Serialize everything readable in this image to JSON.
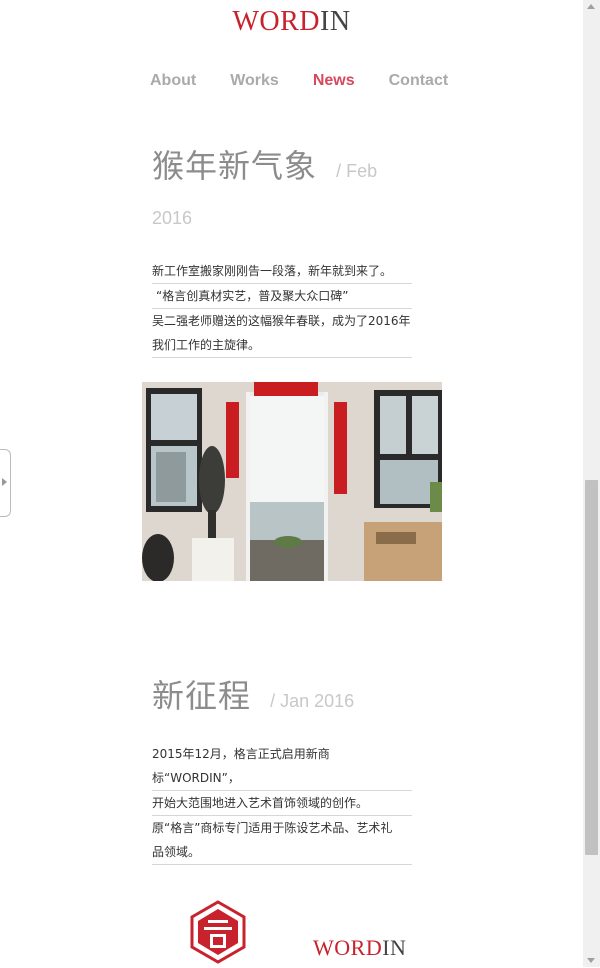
{
  "logo": {
    "part1": "WORD",
    "part2": "IN"
  },
  "nav": [
    {
      "label": "About",
      "active": false
    },
    {
      "label": "Works",
      "active": false
    },
    {
      "label": "News",
      "active": true
    },
    {
      "label": "Contact",
      "active": false
    }
  ],
  "colors": {
    "brand_red": "#c8222c",
    "nav_active": "#d8485d",
    "nav_inactive": "#aaaaaa"
  },
  "articles": [
    {
      "title": "猴年新气象",
      "date_part1": "/ Feb",
      "date_part2": "2016",
      "lines": [
        "新工作室搬家刚刚告一段落，新年就到来了。",
        "“格言创真材实艺，普及聚大众口碑”",
        "吴二强老师赠送的这幅猴年春联，成为了2016年",
        "我们工作的主旋律。"
      ]
    },
    {
      "title": "新征程",
      "date": "/ Jan 2016",
      "lines": [
        "2015年12月，格言正式启用新商",
        "标“WORDIN”，",
        "开始大范围地进入艺术首饰领域的创作。",
        "原“格言”商标专门适用于陈设艺术品、艺术礼",
        "品领域。"
      ]
    }
  ],
  "footer_logo": {
    "part1": "WORD",
    "part2": "IN"
  }
}
